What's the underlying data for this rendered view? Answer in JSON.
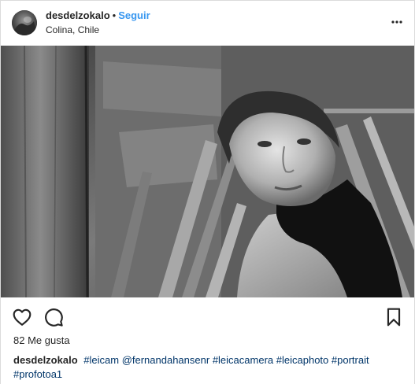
{
  "post": {
    "username": "desdelzokalo",
    "separator": "•",
    "follow_label": "Seguir",
    "location": "Colina, Chile",
    "more_icon": "more-horizontal-icon",
    "likes_text": "82 Me gusta",
    "caption": {
      "username": "desdelzokalo",
      "tags": [
        "#leicam",
        "@fernandahansenr",
        "#leicacamera",
        "#leicaphoto",
        "#portrait",
        "#profotoa1"
      ]
    }
  },
  "actions": {
    "like_icon": "heart-icon",
    "comment_icon": "comment-icon",
    "save_icon": "bookmark-icon"
  },
  "colors": {
    "link_blue": "#3897f0",
    "hashtag": "#003569",
    "text": "#262626",
    "border": "#dbdbdb"
  }
}
